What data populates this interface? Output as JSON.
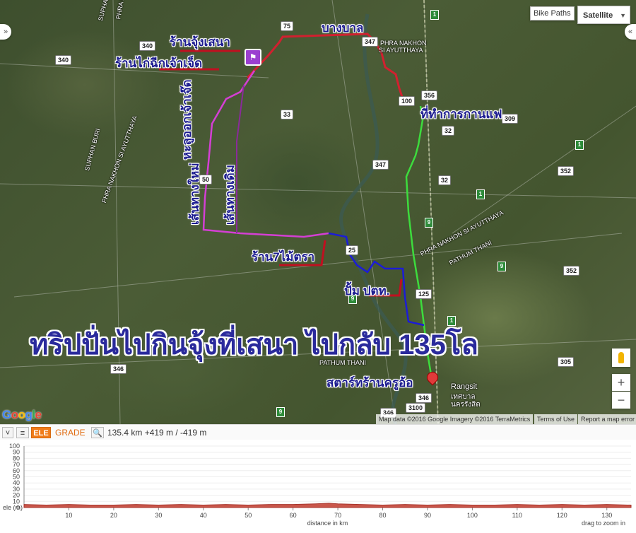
{
  "map": {
    "type_control": "Satellite",
    "bike_paths_label": "Bike Paths",
    "title_overlay": "ทริปปั่นไปกินจุ้งที่เสนา ไปกลับ 135โล",
    "annotations": {
      "shop_jung_sena": "ร้านจุ้งเสนา",
      "shop_chicken": "ร้านไก่ฉีกเจ้าเจ็ด",
      "bang_ban": "บางบาล",
      "district_office": "ที่ทำการกานแฟ",
      "turn_left": "หะลูออกเจ้าเจ๊ด",
      "new_route": "เส้นทางใหม่",
      "old_route": "เส้นทางเดิม",
      "shop_7_mai": "ร้าน7ไม้ตรา",
      "gas_station": "ปั้ม ปตท.",
      "start_shop": "สตาร์ทร้านครูอ้อ"
    },
    "places": {
      "suphan_buri_1": "SUPHAN BURI",
      "suphan_buri_2": "SUPHAN BURI",
      "pnsa_1": "PHRA NAKHON SI AYUTTHAYA",
      "pnsa_2": "PHRA NAKHON SI AYUTTHAYA",
      "ayutthaya_city_1": "PHRA NAKHON",
      "ayutthaya_city_2": "SI AYUTTHAYA",
      "pnsa_3": "PHRA NAKHON SI AYUTTHAYA",
      "pathum_thani_1": "PATHUM THANI",
      "pathum_thani_2": "PATHUM THANI",
      "rangsit_1": "Rangsit",
      "rangsit_2": "เทศบาล",
      "rangsit_3": "นครรังสิต"
    },
    "roads": {
      "r340a": "340",
      "r340b": "340",
      "r75": "75",
      "r347a": "347",
      "r356": "356",
      "r100": "100",
      "r309": "309",
      "r32a": "32",
      "r33": "33",
      "r347b": "347",
      "r32b": "32",
      "r352a": "352",
      "r50": "50",
      "r25": "25",
      "r125": "125",
      "r352b": "352",
      "r346a": "346",
      "r346b": "346",
      "r3100": "3100",
      "r305": "305",
      "r346c": "346"
    },
    "attribution": {
      "map_data": "Map data ©2016 Google Imagery ©2016 TerraMetrics",
      "terms": "Terms of Use",
      "report": "Report a map error"
    },
    "google": "Google",
    "zoom_in": "+",
    "zoom_out": "−",
    "side_left": "»",
    "side_right": "«",
    "colors": {
      "route_red": "#d1202f",
      "route_green": "#3ddc3d",
      "route_blue": "#1c1cd6",
      "route_magenta": "#d43fd4",
      "route_purple": "#8a2a9a"
    }
  },
  "elevation_bar": {
    "collapse_icon": "chevron-down-icon",
    "list_icon": "list-icon",
    "ele_label": "ELE",
    "grade_label": "GRADE",
    "zoom_icon": "magnify-icon",
    "summary": "135.4 km +419 m / -419 m"
  },
  "chart_data": {
    "type": "area",
    "ylabel": "ele (m)",
    "xlabel": "distance in km",
    "hint": "drag to zoom in",
    "ylim": [
      0,
      100
    ],
    "xlim": [
      0,
      135.4
    ],
    "y_ticks": [
      "100",
      "90",
      "80",
      "70",
      "60",
      "50",
      "40",
      "30",
      "20",
      "10",
      "0"
    ],
    "x_ticks": [
      "10",
      "20",
      "30",
      "40",
      "50",
      "60",
      "70",
      "80",
      "90",
      "100",
      "110",
      "120",
      "130"
    ],
    "fill_color": "#c9564a",
    "series": [
      {
        "x": [
          0,
          5,
          10,
          15,
          20,
          25,
          30,
          35,
          40,
          45,
          50,
          55,
          60,
          65,
          68,
          70,
          75,
          80,
          85,
          90,
          95,
          100,
          105,
          110,
          115,
          120,
          125,
          130,
          135.4
        ],
        "y": [
          5,
          4,
          5,
          4,
          4,
          5,
          4,
          5,
          4,
          5,
          4,
          5,
          5,
          6,
          7,
          6,
          5,
          4,
          5,
          4,
          5,
          4,
          4,
          5,
          4,
          5,
          4,
          5,
          4
        ]
      }
    ]
  }
}
